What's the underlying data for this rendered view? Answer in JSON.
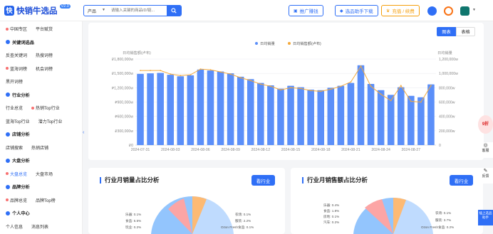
{
  "header": {
    "logo_mark": "快",
    "logo_text": "快销牛选品",
    "logo_badge": "V2.0",
    "search_category": "产品",
    "search_placeholder": "请输入关键的商品ID/链...",
    "buttons": [
      {
        "label": "推广赚钱"
      },
      {
        "label": "选品助手下载"
      },
      {
        "label": "充值 / 续费"
      }
    ]
  },
  "sidebar": {
    "rows": [
      {
        "items": [
          {
            "label": "中国专区",
            "dot": true
          },
          {
            "label": "平台赋货",
            "dot": false
          }
        ]
      },
      {
        "head": "关键词选品"
      },
      {
        "items": [
          {
            "label": "反查关键词",
            "dot": false
          },
          {
            "label": "热搜词榜",
            "dot": false
          }
        ]
      },
      {
        "items": [
          {
            "label": "蓝海词榜",
            "dot": true
          },
          {
            "label": "机会词榜",
            "dot": false
          }
        ]
      },
      {
        "items": [
          {
            "label": "黑开词榜",
            "dot": false
          }
        ]
      },
      {
        "head": "行业分析"
      },
      {
        "items": [
          {
            "label": "行业总览",
            "dot": false
          },
          {
            "label": "热销Top行业",
            "dot": true
          }
        ]
      },
      {
        "items": [
          {
            "label": "蓝海Top行业",
            "dot": false
          },
          {
            "label": "潜力Top行业",
            "dot": false
          }
        ]
      },
      {
        "head": "店铺分析"
      },
      {
        "items": [
          {
            "label": "店铺搜索",
            "dot": false
          },
          {
            "label": "热销店铺",
            "dot": false
          }
        ]
      },
      {
        "head": "大盘分析"
      },
      {
        "items": [
          {
            "label": "大盘总览",
            "dot": true,
            "active": true
          },
          {
            "label": "大盘市场",
            "dot": false
          }
        ]
      },
      {
        "head": "品牌分析"
      },
      {
        "items": [
          {
            "label": "品牌总览",
            "dot": true
          },
          {
            "label": "品牌Top榜",
            "dot": false
          }
        ]
      },
      {
        "head": "个人中心"
      },
      {
        "items": [
          {
            "label": "个人信息",
            "dot": false
          },
          {
            "label": "消息列表",
            "dot": false
          }
        ]
      }
    ]
  },
  "view_toggle": {
    "chart_label": "图表",
    "table_label": "表格"
  },
  "chart_data": {
    "type": "bar",
    "legend": [
      "日均销量",
      "日均销售额(卢布)"
    ],
    "left_axis_label": "日均销售额(卢布)",
    "right_axis_label": "日均销量",
    "left_ticks": [
      "₽0",
      "₽300,000w",
      "₽600,000w",
      "₽900,000w",
      "₽1,200,000w",
      "₽1,500,000w",
      "₽1,800,000w"
    ],
    "right_ticks": [
      "0",
      "200,000w",
      "400,000w",
      "600,000w",
      "800,000w",
      "1,000,000w",
      "1,200,000w"
    ],
    "x_tick_labels": [
      "2024-07-31",
      "2024-08-03",
      "2024-08-06",
      "2024-08-09",
      "2024-08-12",
      "2024-08-15",
      "2024-08-18",
      "2024-08-21",
      "2024-08-24",
      "2024-08-27"
    ],
    "ylim_left": [
      0,
      1800000
    ],
    "ylim_right": [
      0,
      1200000
    ],
    "bar_series": {
      "name": "日均销售额(卢布)",
      "values": [
        1490000,
        1500000,
        1510000,
        1470000,
        1440000,
        1460000,
        1580000,
        1560000,
        1540000,
        1500000,
        1430000,
        1380000,
        1300000,
        1250000,
        1180000,
        1240000,
        1210000,
        1160000,
        1150000,
        1200000,
        1240000,
        1300000,
        1670000,
        1280000,
        1150000,
        1050000,
        1210000,
        1030000,
        1000000,
        1270000
      ]
    },
    "line_series": {
      "name": "日均销量",
      "values": [
        1040000,
        1040000,
        1040000,
        990000,
        970000,
        980000,
        1060000,
        1050000,
        1020000,
        990000,
        940000,
        900000,
        850000,
        820000,
        770000,
        800000,
        790000,
        760000,
        750000,
        780000,
        820000,
        880000,
        1100000,
        820000,
        710000,
        620000,
        830000,
        610000,
        600000,
        830000
      ]
    }
  },
  "cards": {
    "left": {
      "title": "行业月销量占比分析",
      "button": "看行业",
      "labels_left": [
        "乐器: 0.1%",
        "食品: 5.5%",
        "玩业: 0.2%"
      ],
      "labels_right": [
        "农场: 0.1%",
        "服装: 2.2%",
        "Ozon Fresh食品: 0.1%"
      ]
    },
    "right": {
      "title": "行业月销售额占比分析",
      "button": "看行业",
      "labels_left": [
        "乐器: 0.4%",
        "食品: 1.8%",
        "房地: 0.1%",
        "汽车: 0.2%"
      ],
      "labels_right": [
        "农场: 0.1%",
        "服装: 3.7%",
        "Ozon Fresh食品: 0.2%"
      ]
    }
  },
  "float_bar": {
    "customer_service": "客服",
    "feedback": "反馈",
    "assistant": "插上选品助手",
    "badge": "9折"
  }
}
